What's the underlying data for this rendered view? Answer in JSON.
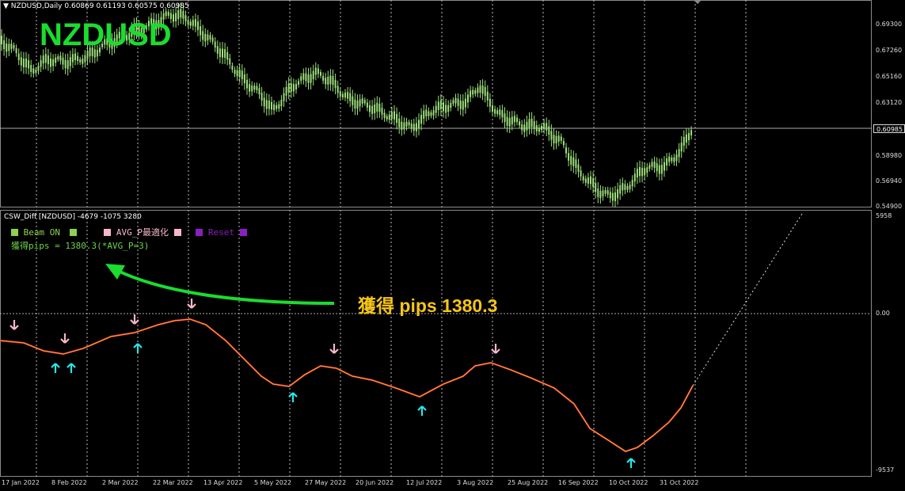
{
  "price_header": {
    "symbol_tf": "NZDUSD,Daily",
    "ohlc": "0.60869 0.61193 0.60575 0.60985"
  },
  "symbol_title": "NZDUSD",
  "price_axis": {
    "labels": [
      "0.69300",
      "0.67260",
      "0.65160",
      "0.63120",
      "0.58980",
      "0.56940",
      "0.54900"
    ],
    "current": "0.60985"
  },
  "indicator_header": {
    "name": "CSW_Diff [NZDUSD]",
    "values": "-4679 -1075 3280"
  },
  "indicator_axis": {
    "top": "5958",
    "zero": "0.00",
    "bottom": "-9537"
  },
  "legend": {
    "beam": "Beam ON",
    "avg": "AVG_P最適化",
    "reset": "Reset",
    "pips_line": "獲得pips = 1380.3(*AVG_P=3)"
  },
  "annotation": "獲得 pips 1380.3",
  "time_axis": [
    "17 Jan 2022",
    "8 Feb 2022",
    "2 Mar 2022",
    "22 Mar 2022",
    "13 Apr 2022",
    "5 May 2022",
    "27 May 2022",
    "20 Jun 2022",
    "12 Jul 2022",
    "3 Aug 2022",
    "25 Aug 2022",
    "16 Sep 2022",
    "10 Oct 2022",
    "31 Oct 2022"
  ],
  "colors": {
    "background": "#000000",
    "candles": "#9ee07d",
    "title": "#1bdc2f",
    "curve_red": "#e0301e",
    "curve_yellow": "#f2c14e",
    "arrow_up": "#28e6e6",
    "arrow_down": "#f5b8c8",
    "annotation": "#f5c518",
    "beam_sq": "#8fd14f",
    "avg_sq": "#f5b8c8",
    "reset_sq": "#8a1fc2",
    "big_arrow": "#1bdc2f"
  }
}
